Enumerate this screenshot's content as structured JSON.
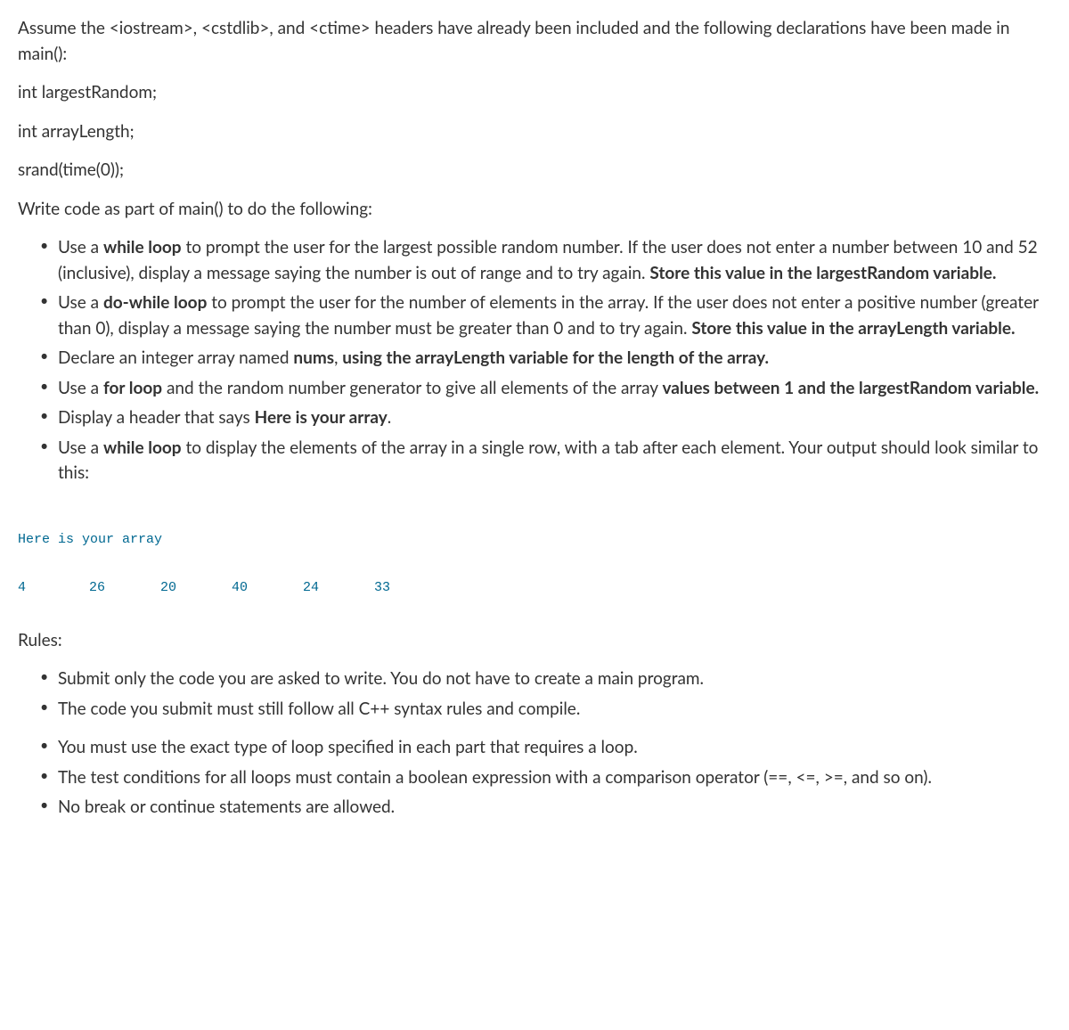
{
  "intro": {
    "line1": "Assume the <iostream>, <cstdlib>, and <ctime> headers have already been included and the following declarations have been made in main():",
    "decl1": "int largestRandom;",
    "decl2": "int arrayLength;",
    "decl3": "srand(time(0));",
    "instruction": "Write code as part of main() to do the following:"
  },
  "task_list": {
    "item1_a": "Use a ",
    "item1_b": "while loop",
    "item1_c": " to prompt the user for the largest possible random number. If the user does not enter a number between 10 and 52 (inclusive), display a message saying the number is out of range and to try again. ",
    "item1_d": "Store this value in the largestRandom variable.",
    "item2_a": "Use a ",
    "item2_b": "do-while loop",
    "item2_c": " to prompt the user for the number of elements in the array. If the user does not enter a positive number (greater than 0), display a message saying the number must be greater than 0 and to try again. ",
    "item2_d": "Store this value in the arrayLength variable.",
    "item3_a": "Declare an integer array named ",
    "item3_b": "nums",
    "item3_c": ", ",
    "item3_d": "using the arrayLength variable for the length of the array.",
    "item4_a": "Use a ",
    "item4_b": "for loop",
    "item4_c": " and the random number generator to give all elements of the array ",
    "item4_d": "values between 1 and the largestRandom variable.",
    "item5_a": "Display a header that says ",
    "item5_b": "Here is your array",
    "item5_c": ".",
    "item6_a": "Use a ",
    "item6_b": "while loop",
    "item6_c": " to display the elements of the array in a single row, with a tab after each element. Your output should look similar to this:"
  },
  "output": {
    "header": "Here is your array",
    "v1": "4",
    "v2": "26",
    "v3": "20",
    "v4": "40",
    "v5": "24",
    "v6": "33"
  },
  "rules": {
    "header": "Rules:",
    "r1": "Submit only the code you are asked to write. You do not have to create a main program.",
    "r2": "The code you submit must still follow all C++ syntax rules and compile.",
    "r3": "You must use the exact type of loop specified in each part that requires a loop.",
    "r4": "The test conditions for all loops must contain a boolean expression with a comparison operator (==, <=, >=, and so on).",
    "r5": "No break or continue statements are allowed."
  }
}
